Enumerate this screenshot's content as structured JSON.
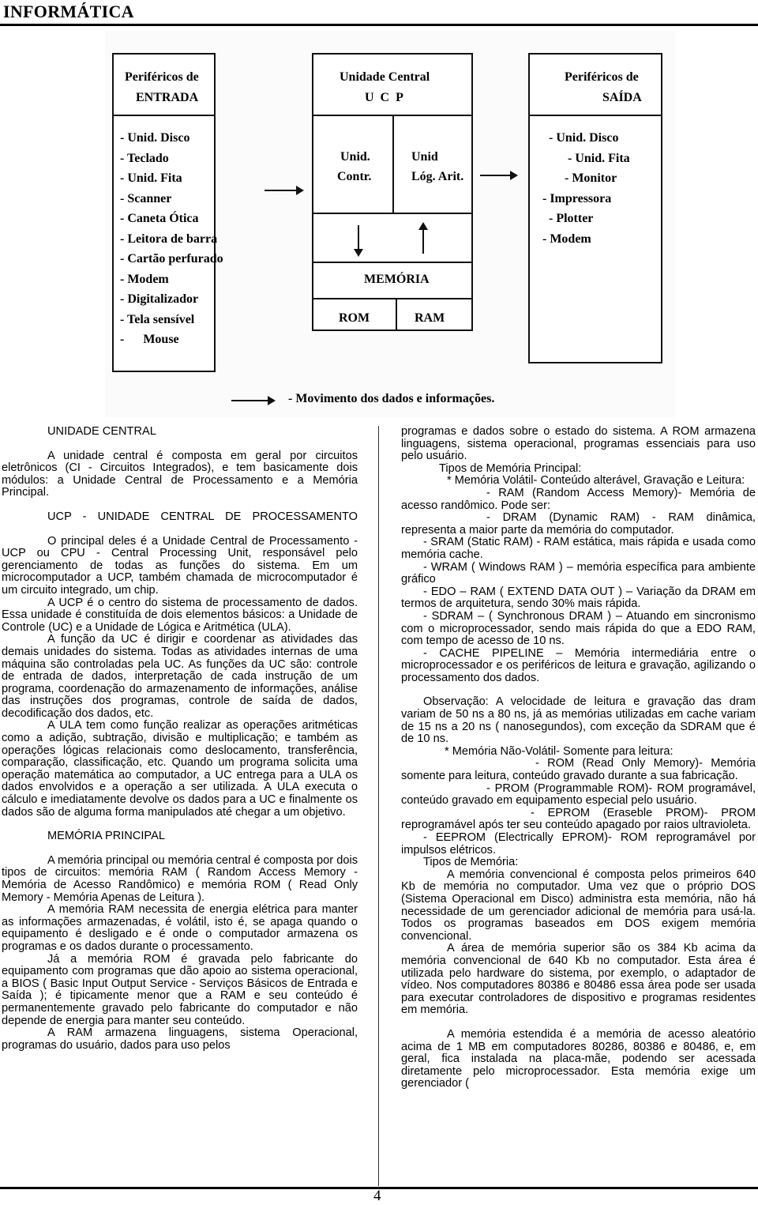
{
  "header": {
    "title": "INFORMÁTICA"
  },
  "diagram": {
    "input_box": {
      "title_line1": "Periféricos de",
      "title_line2": "ENTRADA",
      "items": [
        "- Unid. Disco",
        "- Teclado",
        "- Unid. Fita",
        "- Scanner",
        "- Caneta Ótica",
        "- Leitora de barra",
        "- Cartão perfurado",
        "- Modem",
        "- Digitalizador",
        "- Tela sensível",
        "-      Mouse"
      ]
    },
    "central_box": {
      "title_line1": "Unidade Central",
      "title_line2": "U  C  P",
      "control_line1": "Unid.",
      "control_line2": "Contr.",
      "alu_line1": "Unid",
      "alu_line2": "Lóg. Arit.",
      "memory_label": "MEMÓRIA",
      "rom_label": "ROM",
      "ram_label": "RAM"
    },
    "output_box": {
      "title_line1": "Periféricos de",
      "title_line2": "SAÍDA",
      "items": [
        "- Unid. Disco",
        "- Unid. Fita",
        "- Monitor",
        "- Impressora",
        "- Plotter",
        "- Modem"
      ]
    },
    "legend": "- Movimento dos dados e informações."
  },
  "left_column": {
    "p1_heading": "UNIDADE CENTRAL",
    "p2": "A unidade central é composta em geral por circuitos eletrônicos (CI - Circuitos Integrados), e tem basicamente dois módulos: a Unidade Central de Processamento e a Memória Principal.",
    "p3_heading": "UCP - UNIDADE CENTRAL DE PROCESSAMENTO",
    "p4": "O principal deles é a Unidade Central de Processamento - UCP ou CPU - Central Processing Unit, responsável pelo gerenciamento de todas as funções do sistema. Em um microcomputador a UCP, também chamada de microcomputador é um circuito integrado, um chip.",
    "p5": "A UCP é o centro do sistema de processamento de dados. Essa unidade é constituída de dois elementos básicos: a Unidade de Controle (UC) e a Unidade de Lógica e Aritmética (ULA).",
    "p6": "A função da UC é dirigir e coordenar as atividades das demais unidades do sistema. Todas as atividades internas de uma máquina são controladas pela UC. As funções da UC são: controle de entrada de dados, interpretação de cada instrução de um programa, coordenação do armazenamento de informações, análise das instruções dos programas, controle de saída de dados, decodificação dos dados, etc.",
    "p7": "A ULA tem como função realizar as operações aritméticas como a adição, subtração, divisão e multiplicação; e também as operações lógicas relacionais como deslocamento, transferência, comparação, classificação, etc. Quando um programa solicita uma operação matemática ao computador, a UC entrega para a ULA os dados envolvidos e a operação a ser utilizada. A ULA executa o cálculo e imediatamente devolve os dados para a UC e finalmente os dados são de alguma forma manipulados até chegar a um objetivo.",
    "p8_heading": "MEMÓRIA PRINCIPAL",
    "p9": "A memória principal ou memória central é composta por dois tipos de circuitos: memória RAM ( Random Access Memory - Memória de Acesso Randômico) e memória ROM ( Read Only Memory - Memória Apenas de Leitura ).",
    "p10": "A memória RAM necessita de energia elétrica para manter as informações armazenadas, é volátil, isto é, se apaga quando o equipamento é desligado e é onde o computador armazena os programas e os dados durante o processamento.",
    "p11": "Já a memória ROM é gravada pelo fabricante do equipamento com programas que dão apoio ao sistema operacional, a BIOS ( Basic Input Output Service - Serviços Básicos de Entrada e Saída ); é tipicamente menor que a RAM e seu conteúdo é permanentemente gravado pelo fabricante do computador e não depende de energia para manter seu conteúdo.",
    "p12": "A RAM armazena linguagens, sistema Operacional, programas do usuário, dados para uso pelos"
  },
  "right_column": {
    "p1": "programas e dados sobre o estado do sistema. A ROM armazena linguagens, sistema operacional, programas essenciais para uso pelo usuário.",
    "p2": "Tipos de Memória Principal:",
    "p3": "* Memória Volátil- Conteúdo alterável, Gravação e Leitura:",
    "p4": "- RAM (Random Access Memory)- Memória de acesso randômico. Pode ser:",
    "p5": "- DRAM (Dynamic RAM) - RAM dinâmica, representa a maior parte da memória do computador.",
    "p6": "- SRAM (Static RAM) - RAM estática, mais rápida e usada como memória cache.",
    "p7": "- WRAM ( Windows RAM ) – memória específica para ambiente gráfico",
    "p8": "- EDO – RAM ( EXTEND DATA OUT ) – Variação da DRAM em termos de arquitetura, sendo 30% mais rápida.",
    "p9": "- SDRAM – ( Synchronous DRAM ) – Atuando em sincronismo com o microprocessador, sendo mais rápida do que a EDO RAM, com tempo de acesso de 10 ns.",
    "p10": "- CACHE PIPELINE – Memória intermediária entre o microprocessador e os periféricos de leitura e gravação, agilizando o processamento dos dados.",
    "p11": "Observação: A velocidade de leitura e gravação das dram variam de 50 ns a 80 ns, já as memórias utilizadas em cache variam de 15 ns a 20 ns ( nanosegundos), com exceção da SDRAM que é de 10 ns.",
    "p12": "* Memória Não-Volátil- Somente para leitura:",
    "p13": "- ROM (Read Only Memory)- Memória somente para leitura, conteúdo gravado durante a sua fabricação.",
    "p14": "- PROM (Programmable ROM)- ROM programável, conteúdo gravado em equipamento especial pelo usuário.",
    "p15": "- EPROM (Eraseble PROM)- PROM reprogramável após ter seu conteúdo apagado por raios ultravioleta.",
    "p16": "- EEPROM (Electrically EPROM)- ROM reprogramável por impulsos elétricos.",
    "p17": "Tipos de Memória:",
    "p18": "A memória convencional é composta pelos primeiros 640 Kb de memória no computador. Uma vez que o próprio DOS (Sistema Operacional em Disco) administra esta memória, não há necessidade de um gerenciador adicional de memória para usá-la. Todos os programas baseados em DOS exigem memória convencional.",
    "p19": "A área de memória superior são os 384 Kb acima da memória convencional de 640 Kb no computador. Esta área é utilizada pelo hardware do sistema, por exemplo, o adaptador de vídeo. Nos computadores 80386 e 80486 essa área pode ser usada para executar controladores de dispositivo e programas residentes em memória.",
    "p20": "A memória estendida é a memória de acesso aleatório acima de 1 MB em computadores 80286, 80386 e 80486, e, em geral, fica instalada na placa-mãe, podendo ser acessada diretamente pelo microprocessador. Esta memória exige um gerenciador ("
  },
  "footer": {
    "page_number": "4"
  }
}
